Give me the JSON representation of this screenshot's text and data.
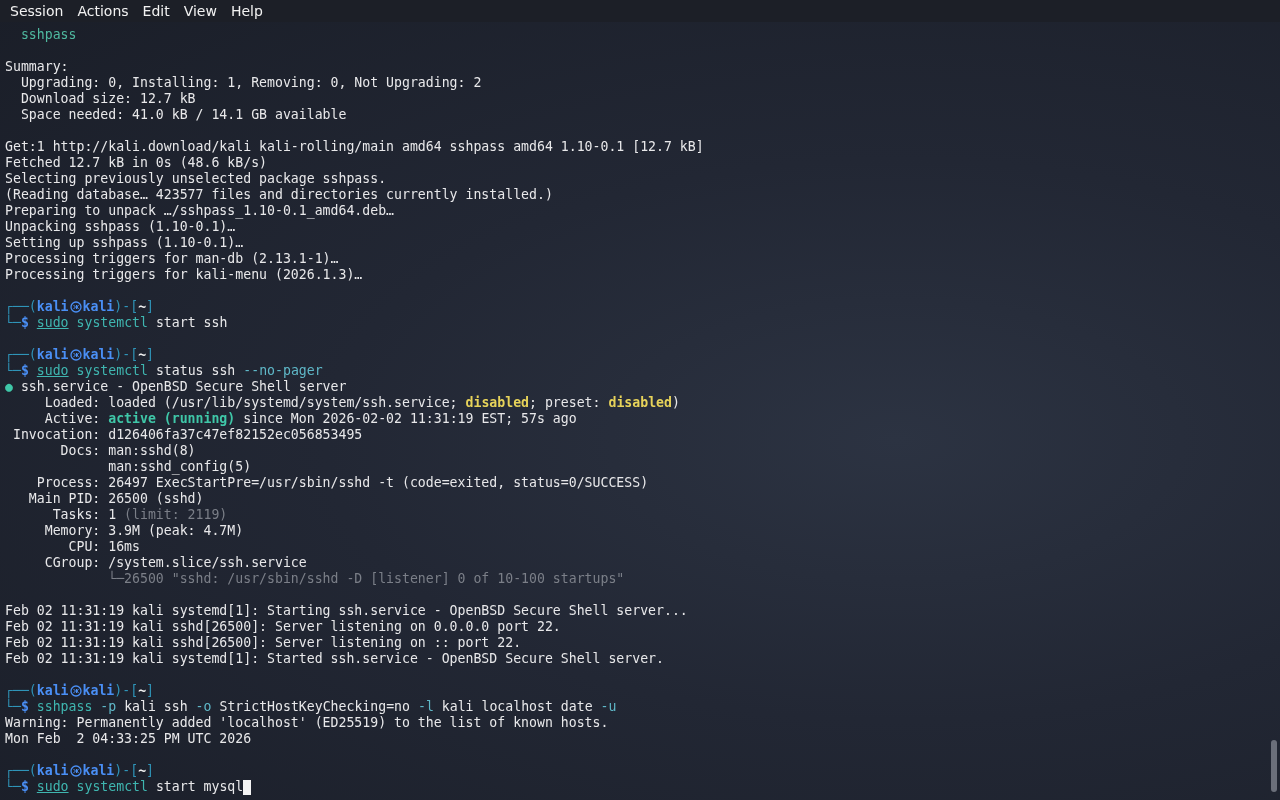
{
  "menu": [
    "Session",
    "Actions",
    "Edit",
    "View",
    "Help"
  ],
  "blocks": [
    {
      "lines": [
        {
          "kind": "output",
          "segments": [
            {
              "kind": "package",
              "text": "  sshpass"
            }
          ]
        }
      ]
    },
    {
      "lines": [
        {
          "kind": "output",
          "segments": [
            {
              "kind": "text",
              "text": "Summary:"
            }
          ]
        },
        {
          "kind": "output",
          "segments": [
            {
              "kind": "text",
              "text": "  Upgrading: 0, Installing: 1, Removing: 0, Not Upgrading: 2"
            }
          ]
        },
        {
          "kind": "output",
          "segments": [
            {
              "kind": "text",
              "text": "  Download size: 12.7 kB"
            }
          ]
        },
        {
          "kind": "output",
          "segments": [
            {
              "kind": "text",
              "text": "  Space needed: 41.0 kB / 14.1 GB available"
            }
          ]
        }
      ]
    },
    {
      "lines": [
        {
          "kind": "output",
          "segments": [
            {
              "kind": "text",
              "text": "Get:1 http://kali.download/kali kali-rolling/main amd64 sshpass amd64 1.10-0.1 [12.7 kB]"
            }
          ]
        },
        {
          "kind": "output",
          "segments": [
            {
              "kind": "text",
              "text": "Fetched 12.7 kB in 0s (48.6 kB/s)"
            }
          ]
        },
        {
          "kind": "output",
          "segments": [
            {
              "kind": "text",
              "text": "Selecting previously unselected package sshpass."
            }
          ]
        },
        {
          "kind": "output",
          "segments": [
            {
              "kind": "text",
              "text": "(Reading database… 423577 files and directories currently installed.)"
            }
          ]
        },
        {
          "kind": "output",
          "segments": [
            {
              "kind": "text",
              "text": "Preparing to unpack …/sshpass_1.10-0.1_amd64.deb…"
            }
          ]
        },
        {
          "kind": "output",
          "segments": [
            {
              "kind": "text",
              "text": "Unpacking sshpass (1.10-0.1)…"
            }
          ]
        },
        {
          "kind": "output",
          "segments": [
            {
              "kind": "text",
              "text": "Setting up sshpass (1.10-0.1)…"
            }
          ]
        },
        {
          "kind": "output",
          "segments": [
            {
              "kind": "text",
              "text": "Processing triggers for man-db (2.13.1-1)…"
            }
          ]
        },
        {
          "kind": "output",
          "segments": [
            {
              "kind": "text",
              "text": "Processing triggers for kali-menu (2026.1.3)…"
            }
          ]
        }
      ]
    },
    {
      "lines": [
        {
          "kind": "prompt",
          "open": "┌──(",
          "user": "kali",
          "host": "kali",
          "mid": ")-[",
          "dir": "~",
          "close": "]"
        },
        {
          "kind": "command",
          "prefix": "└─",
          "symbol": "$",
          "cursor": false,
          "segments": [
            {
              "kind": "sudo",
              "text": "sudo"
            },
            {
              "kind": "tool",
              "text": " systemctl"
            },
            {
              "kind": "text",
              "text": " start ssh"
            }
          ]
        }
      ]
    },
    {
      "lines": [
        {
          "kind": "prompt",
          "open": "┌──(",
          "user": "kali",
          "host": "kali",
          "mid": ")-[",
          "dir": "~",
          "close": "]"
        },
        {
          "kind": "command",
          "prefix": "└─",
          "symbol": "$",
          "cursor": false,
          "segments": [
            {
              "kind": "sudo",
              "text": "sudo"
            },
            {
              "kind": "tool",
              "text": " systemctl"
            },
            {
              "kind": "text",
              "text": " status ssh "
            },
            {
              "kind": "option",
              "text": "--no-pager"
            }
          ]
        },
        {
          "kind": "output",
          "segments": [
            {
              "kind": "dot",
              "text": "●"
            },
            {
              "kind": "text",
              "text": " ssh.service - OpenBSD Secure Shell server"
            }
          ]
        },
        {
          "kind": "output",
          "segments": [
            {
              "kind": "text",
              "text": "     Loaded: loaded (/usr/lib/systemd/system/ssh.service; "
            },
            {
              "kind": "warn",
              "text": "disabled"
            },
            {
              "kind": "text",
              "text": "; preset: "
            },
            {
              "kind": "warn",
              "text": "disabled"
            },
            {
              "kind": "text",
              "text": ")"
            }
          ]
        },
        {
          "kind": "output",
          "segments": [
            {
              "kind": "text",
              "text": "     Active: "
            },
            {
              "kind": "ok",
              "text": "active (running)"
            },
            {
              "kind": "text",
              "text": " since Mon 2026-02-02 11:31:19 EST; 57s ago"
            }
          ]
        },
        {
          "kind": "output",
          "segments": [
            {
              "kind": "text",
              "text": " Invocation: d126406fa37c47ef82152ec056853495"
            }
          ]
        },
        {
          "kind": "output",
          "segments": [
            {
              "kind": "text",
              "text": "       Docs: man:sshd(8)"
            }
          ]
        },
        {
          "kind": "output",
          "segments": [
            {
              "kind": "text",
              "text": "             man:sshd_config(5)"
            }
          ]
        },
        {
          "kind": "output",
          "segments": [
            {
              "kind": "text",
              "text": "    Process: 26497 ExecStartPre=/usr/sbin/sshd -t (code=exited, status=0/SUCCESS)"
            }
          ]
        },
        {
          "kind": "output",
          "segments": [
            {
              "kind": "text",
              "text": "   Main PID: 26500 (sshd)"
            }
          ]
        },
        {
          "kind": "output",
          "segments": [
            {
              "kind": "text",
              "text": "      Tasks: 1 "
            },
            {
              "kind": "dim",
              "text": "(limit: 2119)"
            }
          ]
        },
        {
          "kind": "output",
          "segments": [
            {
              "kind": "text",
              "text": "     Memory: 3.9M (peak: 4.7M)"
            }
          ]
        },
        {
          "kind": "output",
          "segments": [
            {
              "kind": "text",
              "text": "        CPU: 16ms"
            }
          ]
        },
        {
          "kind": "output",
          "segments": [
            {
              "kind": "text",
              "text": "     CGroup: /system.slice/ssh.service"
            }
          ]
        },
        {
          "kind": "output",
          "segments": [
            {
              "kind": "dim",
              "text": "             └─26500 \"sshd: /usr/sbin/sshd -D [listener] 0 of 10-100 startups\""
            }
          ]
        }
      ]
    },
    {
      "lines": [
        {
          "kind": "output",
          "segments": [
            {
              "kind": "text",
              "text": "Feb 02 11:31:19 kali systemd[1]: Starting ssh.service - OpenBSD Secure Shell server..."
            }
          ]
        },
        {
          "kind": "output",
          "segments": [
            {
              "kind": "text",
              "text": "Feb 02 11:31:19 kali sshd[26500]: Server listening on 0.0.0.0 port 22."
            }
          ]
        },
        {
          "kind": "output",
          "segments": [
            {
              "kind": "text",
              "text": "Feb 02 11:31:19 kali sshd[26500]: Server listening on :: port 22."
            }
          ]
        },
        {
          "kind": "output",
          "segments": [
            {
              "kind": "text",
              "text": "Feb 02 11:31:19 kali systemd[1]: Started ssh.service - OpenBSD Secure Shell server."
            }
          ]
        }
      ]
    },
    {
      "lines": [
        {
          "kind": "prompt",
          "open": "┌──(",
          "user": "kali",
          "host": "kali",
          "mid": ")-[",
          "dir": "~",
          "close": "]"
        },
        {
          "kind": "command",
          "prefix": "└─",
          "symbol": "$",
          "cursor": false,
          "segments": [
            {
              "kind": "tool",
              "text": "sshpass"
            },
            {
              "kind": "option",
              "text": " -p"
            },
            {
              "kind": "text",
              "text": " kali ssh"
            },
            {
              "kind": "option",
              "text": " -o"
            },
            {
              "kind": "text",
              "text": " StrictHostKeyChecking=no"
            },
            {
              "kind": "option",
              "text": " -l"
            },
            {
              "kind": "text",
              "text": " kali localhost date"
            },
            {
              "kind": "option",
              "text": " -u"
            }
          ]
        },
        {
          "kind": "output",
          "segments": [
            {
              "kind": "text",
              "text": "Warning: Permanently added 'localhost' (ED25519) to the list of known hosts."
            }
          ]
        },
        {
          "kind": "output",
          "segments": [
            {
              "kind": "text",
              "text": "Mon Feb  2 04:33:25 PM UTC 2026"
            }
          ]
        }
      ]
    },
    {
      "lines": [
        {
          "kind": "prompt",
          "open": "┌──(",
          "user": "kali",
          "host": "kali",
          "mid": ")-[",
          "dir": "~",
          "close": "]"
        },
        {
          "kind": "command",
          "prefix": "└─",
          "symbol": "$",
          "cursor": true,
          "segments": [
            {
              "kind": "sudo",
              "text": "sudo"
            },
            {
              "kind": "tool",
              "text": " systemctl"
            },
            {
              "kind": "text",
              "text": " start mysql"
            }
          ]
        }
      ]
    }
  ]
}
